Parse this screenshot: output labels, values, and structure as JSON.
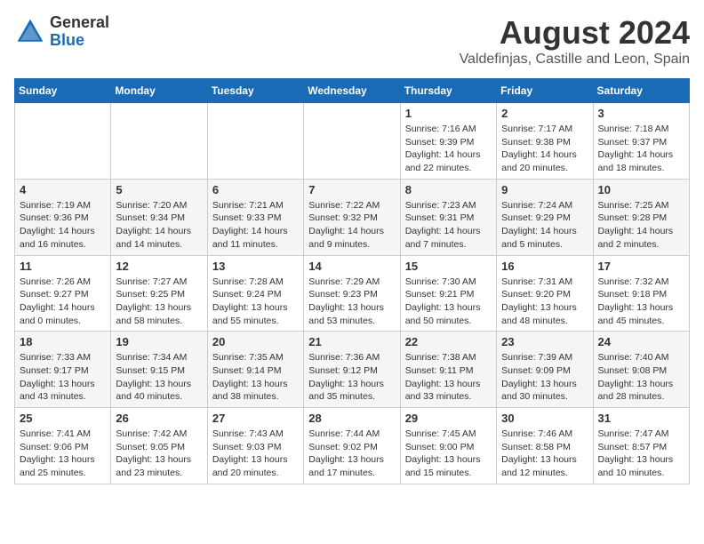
{
  "header": {
    "logo": {
      "general": "General",
      "blue": "Blue"
    },
    "month_year": "August 2024",
    "location": "Valdefinjas, Castille and Leon, Spain"
  },
  "days_of_week": [
    "Sunday",
    "Monday",
    "Tuesday",
    "Wednesday",
    "Thursday",
    "Friday",
    "Saturday"
  ],
  "weeks": [
    [
      {
        "day": "",
        "info": ""
      },
      {
        "day": "",
        "info": ""
      },
      {
        "day": "",
        "info": ""
      },
      {
        "day": "",
        "info": ""
      },
      {
        "day": "1",
        "info": "Sunrise: 7:16 AM\nSunset: 9:39 PM\nDaylight: 14 hours\nand 22 minutes."
      },
      {
        "day": "2",
        "info": "Sunrise: 7:17 AM\nSunset: 9:38 PM\nDaylight: 14 hours\nand 20 minutes."
      },
      {
        "day": "3",
        "info": "Sunrise: 7:18 AM\nSunset: 9:37 PM\nDaylight: 14 hours\nand 18 minutes."
      }
    ],
    [
      {
        "day": "4",
        "info": "Sunrise: 7:19 AM\nSunset: 9:36 PM\nDaylight: 14 hours\nand 16 minutes."
      },
      {
        "day": "5",
        "info": "Sunrise: 7:20 AM\nSunset: 9:34 PM\nDaylight: 14 hours\nand 14 minutes."
      },
      {
        "day": "6",
        "info": "Sunrise: 7:21 AM\nSunset: 9:33 PM\nDaylight: 14 hours\nand 11 minutes."
      },
      {
        "day": "7",
        "info": "Sunrise: 7:22 AM\nSunset: 9:32 PM\nDaylight: 14 hours\nand 9 minutes."
      },
      {
        "day": "8",
        "info": "Sunrise: 7:23 AM\nSunset: 9:31 PM\nDaylight: 14 hours\nand 7 minutes."
      },
      {
        "day": "9",
        "info": "Sunrise: 7:24 AM\nSunset: 9:29 PM\nDaylight: 14 hours\nand 5 minutes."
      },
      {
        "day": "10",
        "info": "Sunrise: 7:25 AM\nSunset: 9:28 PM\nDaylight: 14 hours\nand 2 minutes."
      }
    ],
    [
      {
        "day": "11",
        "info": "Sunrise: 7:26 AM\nSunset: 9:27 PM\nDaylight: 14 hours\nand 0 minutes."
      },
      {
        "day": "12",
        "info": "Sunrise: 7:27 AM\nSunset: 9:25 PM\nDaylight: 13 hours\nand 58 minutes."
      },
      {
        "day": "13",
        "info": "Sunrise: 7:28 AM\nSunset: 9:24 PM\nDaylight: 13 hours\nand 55 minutes."
      },
      {
        "day": "14",
        "info": "Sunrise: 7:29 AM\nSunset: 9:23 PM\nDaylight: 13 hours\nand 53 minutes."
      },
      {
        "day": "15",
        "info": "Sunrise: 7:30 AM\nSunset: 9:21 PM\nDaylight: 13 hours\nand 50 minutes."
      },
      {
        "day": "16",
        "info": "Sunrise: 7:31 AM\nSunset: 9:20 PM\nDaylight: 13 hours\nand 48 minutes."
      },
      {
        "day": "17",
        "info": "Sunrise: 7:32 AM\nSunset: 9:18 PM\nDaylight: 13 hours\nand 45 minutes."
      }
    ],
    [
      {
        "day": "18",
        "info": "Sunrise: 7:33 AM\nSunset: 9:17 PM\nDaylight: 13 hours\nand 43 minutes."
      },
      {
        "day": "19",
        "info": "Sunrise: 7:34 AM\nSunset: 9:15 PM\nDaylight: 13 hours\nand 40 minutes."
      },
      {
        "day": "20",
        "info": "Sunrise: 7:35 AM\nSunset: 9:14 PM\nDaylight: 13 hours\nand 38 minutes."
      },
      {
        "day": "21",
        "info": "Sunrise: 7:36 AM\nSunset: 9:12 PM\nDaylight: 13 hours\nand 35 minutes."
      },
      {
        "day": "22",
        "info": "Sunrise: 7:38 AM\nSunset: 9:11 PM\nDaylight: 13 hours\nand 33 minutes."
      },
      {
        "day": "23",
        "info": "Sunrise: 7:39 AM\nSunset: 9:09 PM\nDaylight: 13 hours\nand 30 minutes."
      },
      {
        "day": "24",
        "info": "Sunrise: 7:40 AM\nSunset: 9:08 PM\nDaylight: 13 hours\nand 28 minutes."
      }
    ],
    [
      {
        "day": "25",
        "info": "Sunrise: 7:41 AM\nSunset: 9:06 PM\nDaylight: 13 hours\nand 25 minutes."
      },
      {
        "day": "26",
        "info": "Sunrise: 7:42 AM\nSunset: 9:05 PM\nDaylight: 13 hours\nand 23 minutes."
      },
      {
        "day": "27",
        "info": "Sunrise: 7:43 AM\nSunset: 9:03 PM\nDaylight: 13 hours\nand 20 minutes."
      },
      {
        "day": "28",
        "info": "Sunrise: 7:44 AM\nSunset: 9:02 PM\nDaylight: 13 hours\nand 17 minutes."
      },
      {
        "day": "29",
        "info": "Sunrise: 7:45 AM\nSunset: 9:00 PM\nDaylight: 13 hours\nand 15 minutes."
      },
      {
        "day": "30",
        "info": "Sunrise: 7:46 AM\nSunset: 8:58 PM\nDaylight: 13 hours\nand 12 minutes."
      },
      {
        "day": "31",
        "info": "Sunrise: 7:47 AM\nSunset: 8:57 PM\nDaylight: 13 hours\nand 10 minutes."
      }
    ]
  ]
}
